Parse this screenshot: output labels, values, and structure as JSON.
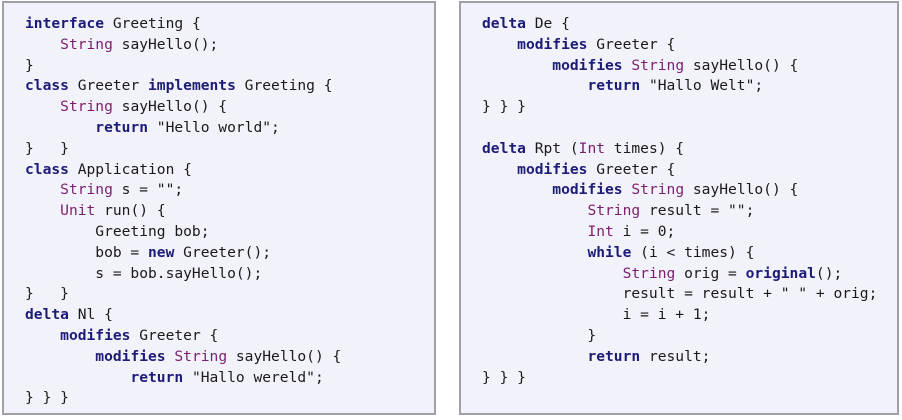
{
  "colors": {
    "background": "#f2f2fa",
    "border": "#a0a0a8",
    "keyword": "#1c1c78",
    "type": "#7a1f6e",
    "text": "#1a1a1a"
  },
  "panels": [
    {
      "name": "code-panel-left",
      "lines": [
        [
          [
            "kw",
            "interface"
          ],
          [
            "plain",
            " Greeting {"
          ]
        ],
        [
          [
            "plain",
            "    "
          ],
          [
            "type",
            "String"
          ],
          [
            "plain",
            " sayHello();"
          ]
        ],
        [
          [
            "plain",
            "}"
          ]
        ],
        [
          [
            "kw",
            "class"
          ],
          [
            "plain",
            " Greeter "
          ],
          [
            "kw",
            "implements"
          ],
          [
            "plain",
            " Greeting {"
          ]
        ],
        [
          [
            "plain",
            "    "
          ],
          [
            "type",
            "String"
          ],
          [
            "plain",
            " sayHello() {"
          ]
        ],
        [
          [
            "plain",
            "        "
          ],
          [
            "kw",
            "return"
          ],
          [
            "plain",
            " \"Hello world\";"
          ]
        ],
        [
          [
            "plain",
            "}   }"
          ]
        ],
        [
          [
            "kw",
            "class"
          ],
          [
            "plain",
            " Application {"
          ]
        ],
        [
          [
            "plain",
            "    "
          ],
          [
            "type",
            "String"
          ],
          [
            "plain",
            " s = \"\";"
          ]
        ],
        [
          [
            "plain",
            "    "
          ],
          [
            "type",
            "Unit"
          ],
          [
            "plain",
            " run() {"
          ]
        ],
        [
          [
            "plain",
            "        Greeting bob;"
          ]
        ],
        [
          [
            "plain",
            "        bob = "
          ],
          [
            "kw",
            "new"
          ],
          [
            "plain",
            " Greeter();"
          ]
        ],
        [
          [
            "plain",
            "        s = bob.sayHello();"
          ]
        ],
        [
          [
            "plain",
            "}   }"
          ]
        ],
        [
          [
            "kw",
            "delta"
          ],
          [
            "plain",
            " Nl {"
          ]
        ],
        [
          [
            "plain",
            "    "
          ],
          [
            "kw",
            "modifies"
          ],
          [
            "plain",
            " Greeter {"
          ]
        ],
        [
          [
            "plain",
            "        "
          ],
          [
            "kw",
            "modifies"
          ],
          [
            "plain",
            " "
          ],
          [
            "type",
            "String"
          ],
          [
            "plain",
            " sayHello() {"
          ]
        ],
        [
          [
            "plain",
            "            "
          ],
          [
            "kw",
            "return"
          ],
          [
            "plain",
            " \"Hallo wereld\";"
          ]
        ],
        [
          [
            "plain",
            "} } }"
          ]
        ]
      ]
    },
    {
      "name": "code-panel-right",
      "lines": [
        [
          [
            "kw",
            "delta"
          ],
          [
            "plain",
            " De {"
          ]
        ],
        [
          [
            "plain",
            "    "
          ],
          [
            "kw",
            "modifies"
          ],
          [
            "plain",
            " Greeter {"
          ]
        ],
        [
          [
            "plain",
            "        "
          ],
          [
            "kw",
            "modifies"
          ],
          [
            "plain",
            " "
          ],
          [
            "type",
            "String"
          ],
          [
            "plain",
            " sayHello() {"
          ]
        ],
        [
          [
            "plain",
            "            "
          ],
          [
            "kw",
            "return"
          ],
          [
            "plain",
            " \"Hallo Welt\";"
          ]
        ],
        [
          [
            "plain",
            "} } }"
          ]
        ],
        [
          [
            "plain",
            ""
          ]
        ],
        [
          [
            "kw",
            "delta"
          ],
          [
            "plain",
            " Rpt ("
          ],
          [
            "type",
            "Int"
          ],
          [
            "plain",
            " times) {"
          ]
        ],
        [
          [
            "plain",
            "    "
          ],
          [
            "kw",
            "modifies"
          ],
          [
            "plain",
            " Greeter {"
          ]
        ],
        [
          [
            "plain",
            "        "
          ],
          [
            "kw",
            "modifies"
          ],
          [
            "plain",
            " "
          ],
          [
            "type",
            "String"
          ],
          [
            "plain",
            " sayHello() {"
          ]
        ],
        [
          [
            "plain",
            "            "
          ],
          [
            "type",
            "String"
          ],
          [
            "plain",
            " result = \"\";"
          ]
        ],
        [
          [
            "plain",
            "            "
          ],
          [
            "type",
            "Int"
          ],
          [
            "plain",
            " i = 0;"
          ]
        ],
        [
          [
            "plain",
            "            "
          ],
          [
            "kw",
            "while"
          ],
          [
            "plain",
            " (i < times) {"
          ]
        ],
        [
          [
            "plain",
            "                "
          ],
          [
            "type",
            "String"
          ],
          [
            "plain",
            " orig = "
          ],
          [
            "kw",
            "original"
          ],
          [
            "plain",
            "();"
          ]
        ],
        [
          [
            "plain",
            "                result = result + \" \" + orig;"
          ]
        ],
        [
          [
            "plain",
            "                i = i + 1;"
          ]
        ],
        [
          [
            "plain",
            "            }"
          ]
        ],
        [
          [
            "plain",
            "            "
          ],
          [
            "kw",
            "return"
          ],
          [
            "plain",
            " result;"
          ]
        ],
        [
          [
            "plain",
            "} } }"
          ]
        ]
      ]
    }
  ]
}
